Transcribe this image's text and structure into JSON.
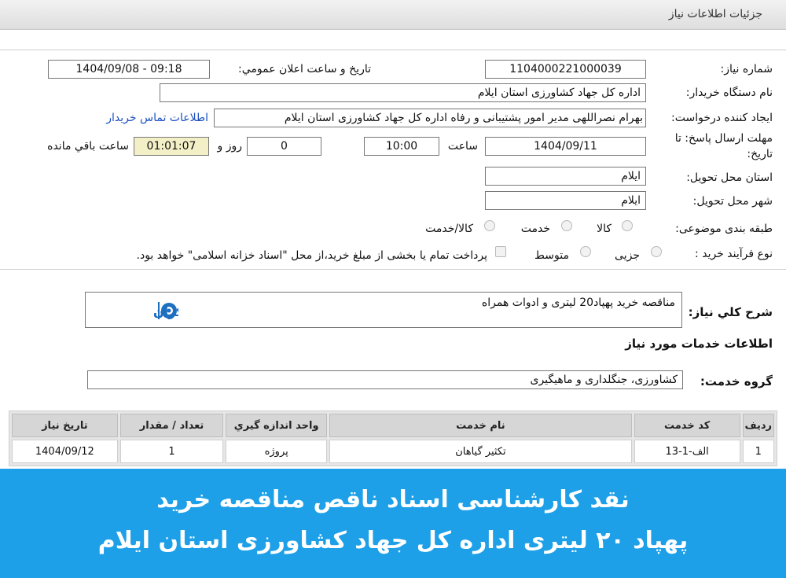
{
  "header": {
    "title": "جزئیات اطلاعات نیاز"
  },
  "form": {
    "need_number_label": "شماره نیاز:",
    "need_number": "1104000221000039",
    "announce_label": "تاریخ و ساعت اعلان عمومي:",
    "announce_value": "1404/09/08 - 09:18",
    "buyer_label": "نام دستگاه خريدار:",
    "buyer_value": "اداره کل جهاد کشاورزی استان ایلام",
    "creator_label": "ایجاد کننده درخواست:",
    "creator_value": "بهرام نصراللهی مدیر امور پشتیبانی و رفاه اداره کل جهاد کشاورزی استان ایلام",
    "contact_link": "اطلاعات تماس خریدار",
    "deadline_label_1": "مهلت ارسال پاسخ: تا",
    "deadline_label_2": "تاریخ:",
    "deadline_date": "1404/09/11",
    "time_label": "ساعت",
    "deadline_time": "10:00",
    "days_value": "0",
    "days_label": "روز و",
    "remaining_value": "01:01:07",
    "remaining_label": "ساعت باقي مانده",
    "province_label": "استان محل تحویل:",
    "province_value": "ایلام",
    "city_label": "شهر محل تحویل:",
    "city_value": "ایلام",
    "category_label": "طبقه بندی موضوعی:",
    "category_options": [
      "کالا",
      "خدمت",
      "کالا/خدمت"
    ],
    "process_label": "نوع فرآیند خرید :",
    "process_options": [
      "جزیی",
      "متوسط"
    ],
    "payment_text": "پرداخت تمام یا بخشی از مبلغ خرید،از محل \"اسناد خزانه اسلامی\" خواهد بود."
  },
  "description": {
    "label": "شرح کلي نياز:",
    "value": "مناقصه خرید پهپاد20 لیتری و ادوات همراه"
  },
  "services_title": "اطلاعات خدمات مورد نیاز",
  "service_group": {
    "label": "گروه خدمت:",
    "value": "کشاورزی، جنگلداری و ماهیگیری"
  },
  "table": {
    "headers": [
      "رديف",
      "کد خدمت",
      "نام خدمت",
      "واحد اندازه گيري",
      "تعداد / مقدار",
      "تاريخ نياز"
    ],
    "rows": [
      [
        "1",
        "الف-1-13",
        "تکثیر گیاهان",
        "پروژه",
        "1",
        "1404/09/12"
      ]
    ]
  },
  "banner": {
    "line1": "نقد کارشناسی اسناد ناقص مناقصه خرید",
    "line2": "پهپاد ۲۰ لیتری اداره کل جهاد کشاورزی استان ایلام"
  },
  "logo_text": "نگاه بیکران",
  "colors": {
    "banner": "#1da0e8",
    "link": "#1a4fc0",
    "remaining_bg": "#f3efc7"
  }
}
